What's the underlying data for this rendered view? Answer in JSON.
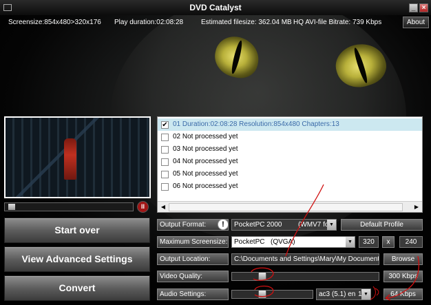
{
  "window": {
    "title": "DVD Catalyst"
  },
  "info": {
    "screensize": "Screensize:854x480>320x176",
    "duration": "Play duration:02:08:28",
    "filesize": "Estimated filesize: 362.04 MB",
    "bitrate": "HQ AVI-file Bitrate: 739 Kbps",
    "about_label": "About"
  },
  "player": {
    "position": 0.02,
    "pause_icon": "pause-icon"
  },
  "buttons": {
    "start_over": "Start over",
    "advanced": "View Advanced Settings",
    "convert": "Convert"
  },
  "titles": [
    {
      "checked": true,
      "text": "01 Duration:02:08:28 Resolution:854x480 Chapters:13"
    },
    {
      "checked": false,
      "text": "02 Not processed yet"
    },
    {
      "checked": false,
      "text": "03 Not processed yet"
    },
    {
      "checked": false,
      "text": "04 Not processed yet"
    },
    {
      "checked": false,
      "text": "05 Not processed yet"
    },
    {
      "checked": false,
      "text": "06 Not processed yet"
    }
  ],
  "settings": {
    "output_format": {
      "label": "Output Format:",
      "value": "PocketPC 2000",
      "value2": "(WMV7 fo",
      "profile_button": "Default Profile"
    },
    "screensize": {
      "label": "Maximum Screensize:",
      "value": "PocketPC",
      "value2": "(QVGA)",
      "width": "320",
      "x": "x",
      "height": "240"
    },
    "location": {
      "label": "Output Location:",
      "value": "C:\\Documents and Settings\\Mary\\My Documents\\V",
      "browse": "Browse"
    },
    "video": {
      "label": "Video Quality:",
      "value": "300 Kbps",
      "level": 0.19
    },
    "audio": {
      "label": "Audio Settings:",
      "codec": "ac3 (5.1) en",
      "bitrate_sel": "128",
      "value": "64 Kbps",
      "level": 0.36
    }
  },
  "colors": {
    "accent_selected_text": "#3a6aa8",
    "selected_row": "#cce8f0",
    "annotation_ink": "#d01010",
    "warning_icon": "#000000"
  }
}
